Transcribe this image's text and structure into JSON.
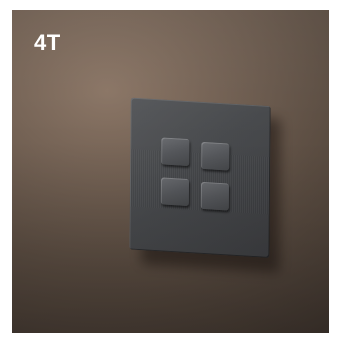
{
  "label": "4T",
  "product": {
    "buttons": 4
  },
  "colors": {
    "background": "#6e5d50",
    "plate": "#46484b",
    "button": "#5a5c60",
    "label": "#ffffff"
  }
}
